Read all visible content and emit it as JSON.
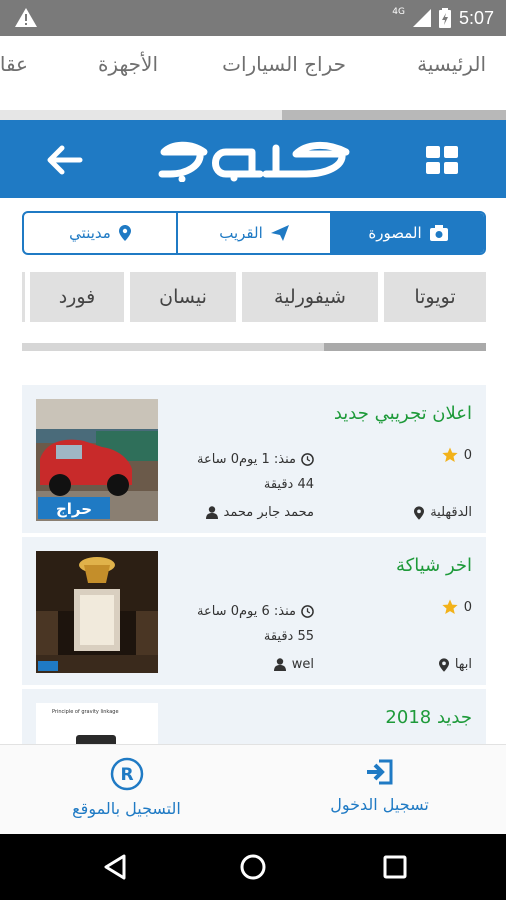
{
  "status_bar": {
    "time": "5:07",
    "network": "4G",
    "icons": [
      "warning-icon",
      "signal-icon",
      "battery-icon"
    ]
  },
  "top_nav": {
    "items": [
      {
        "label": "الرئيسية"
      },
      {
        "label": "حراج السيارات"
      },
      {
        "label": "الأجهزة"
      },
      {
        "label": "عقا"
      }
    ]
  },
  "header": {
    "logo_text": "حراج",
    "colors": {
      "brand": "#1f7ac4"
    }
  },
  "filters": {
    "tabs": [
      {
        "label": "المصورة",
        "icon": "camera-icon",
        "active": true
      },
      {
        "label": "القريب",
        "icon": "send-icon",
        "active": false
      },
      {
        "label": "مدينتي",
        "icon": "location-pin-icon",
        "active": false
      }
    ]
  },
  "brands": {
    "items": [
      "تويوتا",
      "شيفورلية",
      "نيسان",
      "فورد"
    ]
  },
  "listings": [
    {
      "title": "اعلان تجريبي جديد",
      "rating": "0",
      "since_line1": "منذ: 1 يوم0 ساعة",
      "since_line2": "44 دقيقة",
      "city": "الدقهلية",
      "user": "محمد جابر محمد",
      "thumb_label": "حراج"
    },
    {
      "title": "اخر شياكة",
      "rating": "0",
      "since_line1": "منذ: 6 يوم0 ساعة",
      "since_line2": "55 دقيقة",
      "city": "ابها",
      "user": "wel"
    },
    {
      "title": "جديد 2018",
      "thumb_caption": "Principle of gravity linkage"
    }
  ],
  "bottom_tabs": {
    "register_label": "التسجيل بالموقع",
    "login_label": "تسجيل الدخول"
  }
}
